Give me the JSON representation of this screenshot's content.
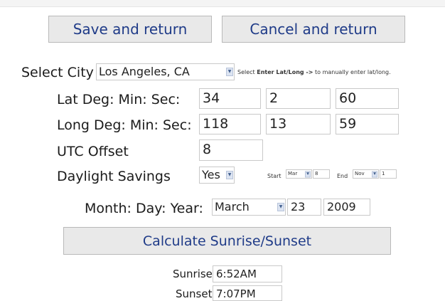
{
  "buttons": {
    "save": "Save and return",
    "cancel": "Cancel and return",
    "calculate": "Calculate Sunrise/Sunset"
  },
  "city": {
    "label": "Select City",
    "value": "Los Angeles, CA",
    "hint_pre": "Select ",
    "hint_bold": "Enter Lat/Long ->",
    "hint_post": " to manually enter lat/long."
  },
  "lat": {
    "label": "Lat Deg: Min: Sec:",
    "deg": "34",
    "min": "2",
    "sec": "60"
  },
  "long": {
    "label": "Long Deg: Min: Sec:",
    "deg": "118",
    "min": "13",
    "sec": "59"
  },
  "utc": {
    "label": "UTC Offset",
    "value": "8"
  },
  "dst": {
    "label": "Daylight Savings",
    "value": "Yes",
    "start_label": "Start",
    "start_month": "Mar",
    "start_day": "8",
    "end_label": "End",
    "end_month": "Nov",
    "end_day": "1"
  },
  "date": {
    "label": "Month: Day: Year:",
    "month": "March",
    "day": "23",
    "year": "2009"
  },
  "results": {
    "sunrise_label": "Sunrise",
    "sunrise_value": "6:52AM",
    "sunset_label": "Sunset",
    "sunset_value": "7:07PM"
  },
  "icons": {
    "dropdown": "chevron-down-icon"
  },
  "colors": {
    "button_text": "#1f3b88",
    "button_bg": "#e9e9e9"
  }
}
